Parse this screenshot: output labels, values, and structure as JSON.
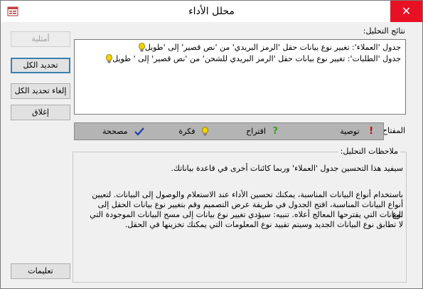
{
  "window": {
    "title": "محلل الأداء",
    "close_glyph": "✕"
  },
  "buttons": {
    "optimize": "أمثلية",
    "select_all": "تحديد الكل",
    "deselect_all": "إلغاء تحديد الكل",
    "close": "إغلاق",
    "help": "تعليمات"
  },
  "results": {
    "label": "نتائج التحليل:",
    "items": [
      "جدول 'العملاء': تغيير نوع بيانات حقل 'الرمز البريدي' من 'نص قصير' إلى 'طويل",
      "جدول 'الطلبات': تغيير نوع بيانات حقل 'الرمز البريدي للشحن' من 'نص قصير' إلى ' طويل"
    ]
  },
  "key": {
    "label": "المفتاح:",
    "recommendation": "توصية",
    "suggestion": "اقتراح",
    "idea": "فكرة",
    "fixed": "مصححة"
  },
  "notes": {
    "label": "ملاحظات التحليل:",
    "paragraph1": "سيفيد هذا التحسين جدول 'العملاء' وربما كائنات أخرى في قاعدة بياناتك.",
    "paragraph2_lines": [
      "باستخدام أنواع البيانات المناسبة، يمكنك تحسين الأداء عند الاستعلام والوصول إلى البيانات. لتعيين",
      "أنواع البيانات المناسبة، افتح الجدول في طريقة عرض التصميم وقم بتغيير نوع بيانات الحقل إلى نوع",
      "البيانات التي يقترحها المعالج أعلاه. تنبيه: سيؤدي تغيير نوع بيانات إلى مسح البيانات الموجودة التي",
      "لا تطابق نوع البيانات الجديد وسيتم تقييد نوع المعلومات التي يمكنك تخزينها في الحقل."
    ]
  },
  "colors": {
    "close_red": "#e81123",
    "bulb_yellow": "#f5d000",
    "check_blue": "#1a3fa8",
    "exclaim_red": "#c00000",
    "question_green": "#3aa020"
  }
}
